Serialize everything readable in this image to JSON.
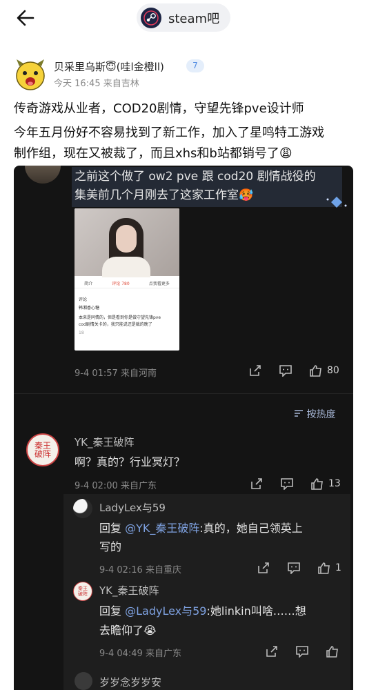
{
  "header": {
    "forum_name": "steam吧"
  },
  "post": {
    "author_name": "贝采里乌斯😇(哇l金橙ll)",
    "level": "7",
    "meta": "今天 16:45 来自吉林",
    "title": "传奇游戏从业者，COD20剧情，守望先锋pve设计师",
    "body_line1": "今年五月份好不容易找到了新工作，加入了星鸣特工游戏",
    "body_line2": "制作组，现在又被裁了，而且xhs和b站都销号了😩"
  },
  "screenshot": {
    "text_line1": "之前这个做了 ow2 pve 跟 cod20 剧情战役的",
    "text_line2": "集美前几个月刚去了这家工作室🥵",
    "photo": {
      "tabs": [
        "简介",
        "评论 780",
        "",
        "点我看更多"
      ],
      "comment_header": "评论",
      "commenter": "韩湘香心糖",
      "comment_line1": "本来是同情的，但是看到你是做守望先锋pve",
      "comment_line2": "cod剧情关卡的，我只能说还是裁的晚了",
      "likes": "18"
    },
    "main_meta": "9-4 01:57 来自河南",
    "main_likes": "80",
    "sort_label": "按热度",
    "comments": [
      {
        "name": "YK_秦王破阵",
        "text": "啊？真的？行业冥灯？",
        "meta": "9-4 02:00 来自广东",
        "likes": "13",
        "seal": "秦王破阵"
      }
    ],
    "replies": [
      {
        "name": "LadyLex与59",
        "prefix": "回复",
        "mention": "@YK_秦王破阵",
        "text_line1": ":真的，她自己领英上",
        "text_line2": "写的",
        "meta": "9-4 02:16 来自重庆",
        "likes": "1"
      },
      {
        "name": "YK_秦王破阵",
        "prefix": "回复",
        "mention": "@LadyLex与59",
        "text_line1": ":她linkin叫啥……想",
        "text_line2": "去瞻仰了😭",
        "meta": "9-4 04:49 来自广东",
        "likes": ""
      }
    ],
    "next_comment_name": "岁岁念岁岁安"
  }
}
